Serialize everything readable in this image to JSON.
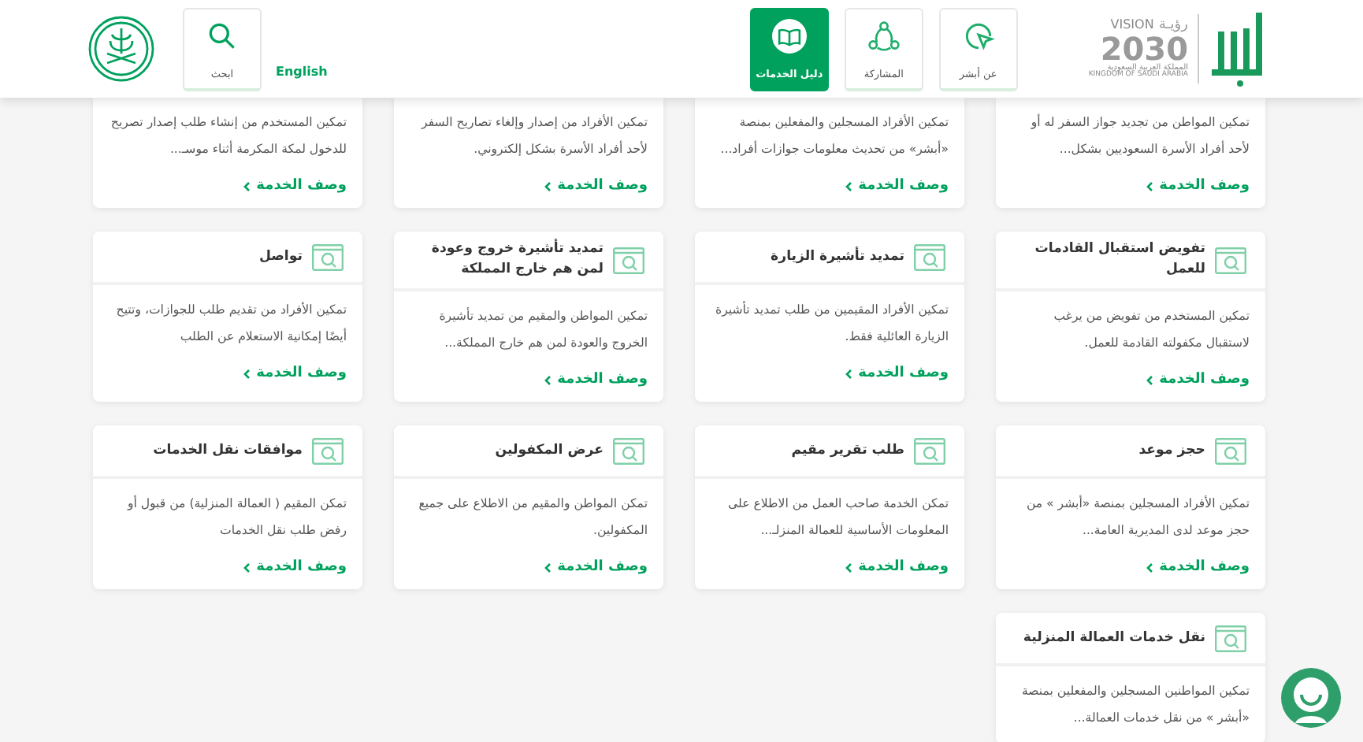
{
  "header": {
    "vision_logo": {
      "arabic": "رؤيـة",
      "latin": "VISION",
      "year": "2030",
      "country_ar": "المملكة العربية السعودية",
      "country_en": "KINGDOM OF SAUDI ARABIA"
    },
    "nav": [
      {
        "label": "عن أبشر",
        "kind": "pointer",
        "selected": false
      },
      {
        "label": "المشاركة",
        "kind": "share",
        "selected": false
      },
      {
        "label": "دليل الخدمات",
        "kind": "book",
        "selected": true
      }
    ],
    "language": "English",
    "search": "ابحث"
  },
  "cards": [
    {
      "description": "تمكين المواطن من تجديد جواز السفر له أو لأحد أفراد الأسرة السعوديين بشكل...",
      "link": "وصف الخدمة"
    },
    {
      "description": "تمكين الأفراد المسجلين والمفعلين بمنصة «أبشر» من تحديث معلومات جوازات أفراد...",
      "link": "وصف الخدمة"
    },
    {
      "description": "تمكين الأفراد من إصدار وإلغاء تصاريح السفر لأحد أفراد الأسرة بشكل إلكتروني.",
      "link": "وصف الخدمة"
    },
    {
      "description": "تمكين المستخدم من إنشاء طلب إصدار تصريح للدخول لمكة المكرمة أثناء موسـ...",
      "link": "وصف الخدمة"
    },
    {
      "title": "تفويض استقبال القادمات للعمل",
      "description": "تمكين المستخدم من تفويض من يرغب لاستقبال مكفولته القادمة للعمل.",
      "link": "وصف الخدمة"
    },
    {
      "title": "تمديد تأشيرة الزيارة",
      "description": "تمكين الأفراد المقيمين من طلب تمديد تأشيرة الزيارة العائلية فقط.",
      "link": "وصف الخدمة"
    },
    {
      "title": "تمديد تأشيرة خروج وعودة لمن هم خارج المملكة",
      "description": "تمكين المواطن والمقيم من تمديد تأشيرة الخروج والعودة لمن هم خارج المملكة...",
      "link": "وصف الخدمة"
    },
    {
      "title": "تواصل",
      "description": "تمكين الأفراد من تقديم طلب للجوازات، وتتيح أيضًا إمكانية الاستعلام عن الطلب",
      "link": "وصف الخدمة"
    },
    {
      "title": "حجز موعد",
      "description": "تمكين الأفراد المسجلين بمنصة «أبشر » من حجز موعد لدى المديرية العامة...",
      "link": "وصف الخدمة"
    },
    {
      "title": "طلب تقرير مقيم",
      "description": "تمكن الخدمة صاحب العمل من الاطلاع على المعلومات الأساسية للعمالة المنزلـ...",
      "link": "وصف الخدمة"
    },
    {
      "title": "عرض المكفولين",
      "description": "تمكن المواطن والمقيم من الاطلاع على جميع المكفولين.",
      "link": "وصف الخدمة"
    },
    {
      "title": "موافقات نقل الخدمات",
      "description": "تمكن المقيم ( العمالة المنزلية) من قبول أو رفض طلب نقل الخدمات",
      "link": "وصف الخدمة"
    },
    {
      "title": "نقل خدمات العمالة المنزلية",
      "description": "تمكين المواطنين المسجلين والمفعلين بمنصة «أبشر » من نقل خدمات العمالة..."
    }
  ]
}
